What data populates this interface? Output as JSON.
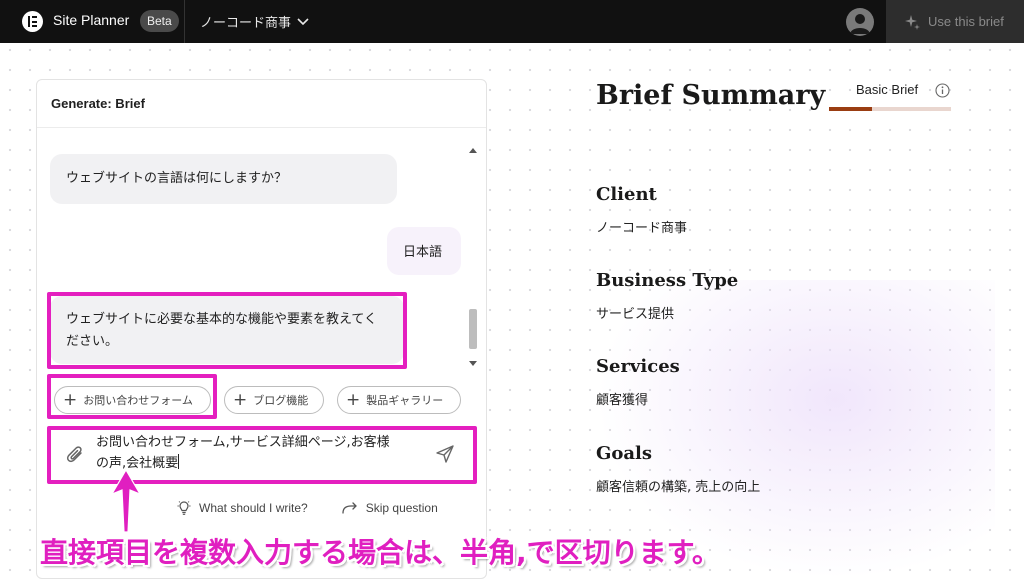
{
  "topbar": {
    "app_title": "Site Planner",
    "badge": "Beta",
    "project_name": "ノーコード商事",
    "use_brief_label": "Use this brief"
  },
  "chat": {
    "header": "Generate: Brief",
    "messages": [
      {
        "role": "bot",
        "text": "ウェブサイトの言語は何にしますか？"
      },
      {
        "role": "user",
        "text": "日本語"
      },
      {
        "role": "bot",
        "text": "ウェブサイトに必要な基本的な機能や要素を教えてください。"
      }
    ],
    "suggestions": [
      "お問い合わせフォーム",
      "ブログ機能",
      "製品ギャラリー"
    ],
    "input_value": "お問い合わせフォーム,サービス詳細ページ,お客様の声,会社概要",
    "what_to_write": "What should I write?",
    "skip_question": "Skip question"
  },
  "annotation": {
    "caption": "直接項目を複数入力する場合は、半角,で区切ります。",
    "color": "#e41fbf"
  },
  "summary": {
    "title": "Brief Summary",
    "tab_label": "Basic Brief",
    "progress": 0.35,
    "accent_color": "#9a3d12",
    "sections": [
      {
        "label": "Client",
        "value": "ノーコード商事"
      },
      {
        "label": "Business Type",
        "value": "サービス提供"
      },
      {
        "label": "Services",
        "value": "顧客獲得"
      },
      {
        "label": "Goals",
        "value": "顧客信頼の構築, 売上の向上"
      }
    ]
  }
}
